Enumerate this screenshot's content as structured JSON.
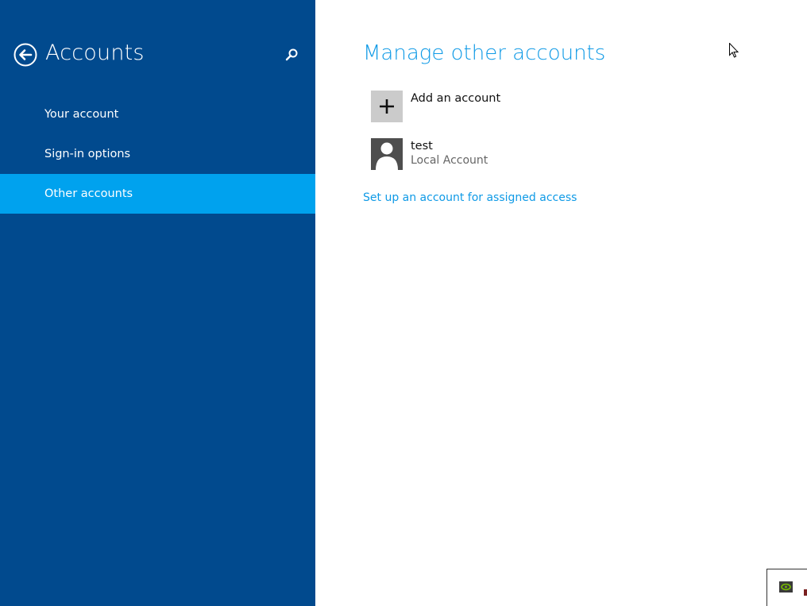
{
  "sidebar": {
    "title": "Accounts",
    "back_icon": "back-arrow-circle-icon",
    "search_icon": "search-icon",
    "items": [
      {
        "label": "Your account",
        "active": false
      },
      {
        "label": "Sign-in options",
        "active": false
      },
      {
        "label": "Other accounts",
        "active": true
      }
    ]
  },
  "main": {
    "title": "Manage other accounts",
    "add_account": {
      "label": "Add an account",
      "icon": "plus-icon"
    },
    "accounts": [
      {
        "name": "test",
        "type": "Local Account",
        "icon": "user-avatar-icon"
      }
    ],
    "assigned_access_link": "Set up an account for assigned access"
  },
  "colors": {
    "sidebar_bg": "#014a8e",
    "active_item": "#00a2ee",
    "accent_text": "#0f9ae6"
  }
}
